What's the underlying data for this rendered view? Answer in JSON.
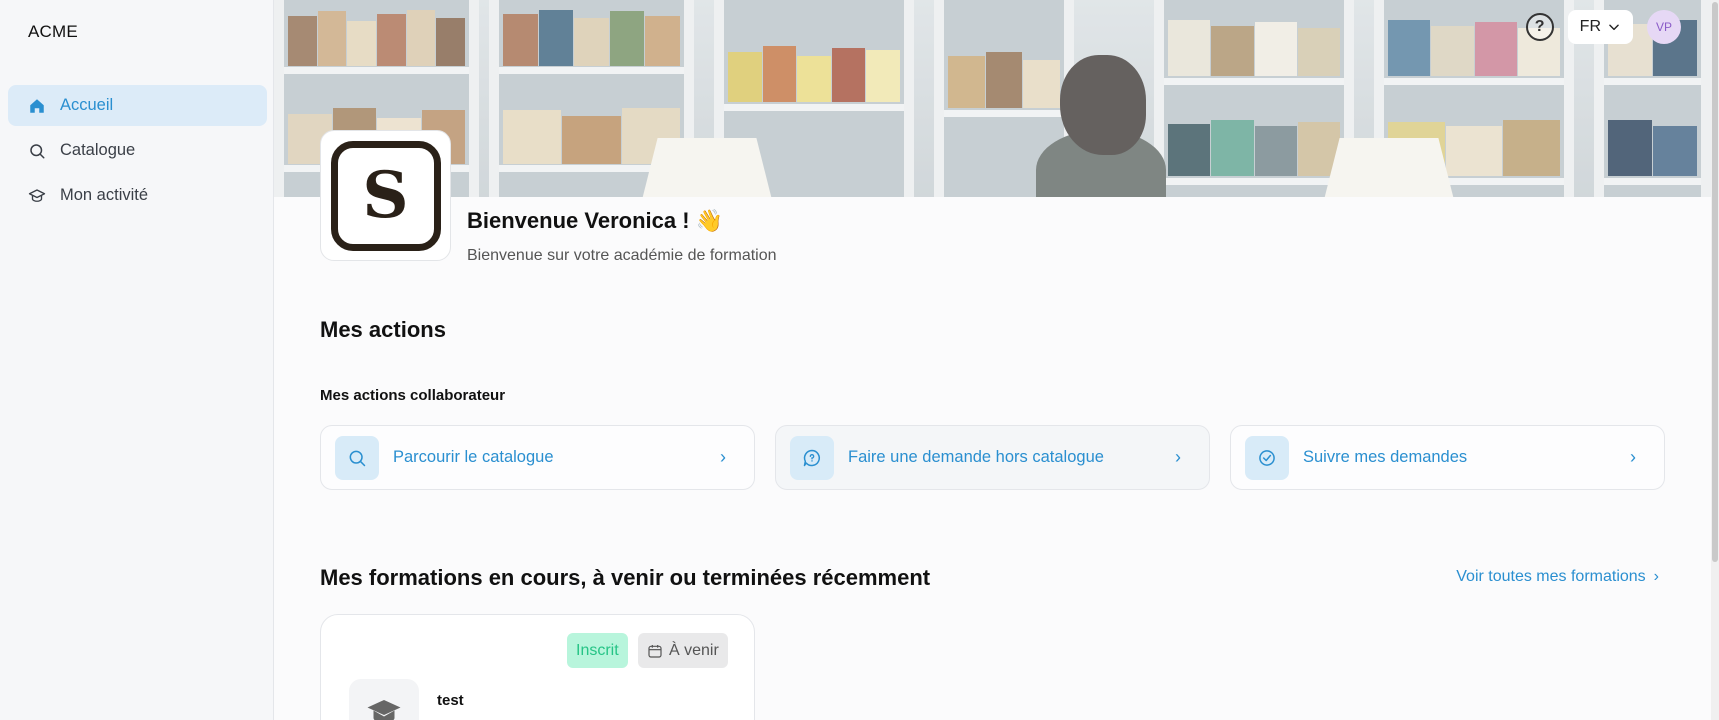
{
  "app": {
    "brand": "ACME"
  },
  "sidebar": {
    "items": [
      {
        "label": "Accueil",
        "icon": "home-icon",
        "active": true
      },
      {
        "label": "Catalogue",
        "icon": "search-icon",
        "active": false
      },
      {
        "label": "Mon activité",
        "icon": "graduation-cap-icon",
        "active": false
      }
    ]
  },
  "header": {
    "help_icon": "help-circle-icon",
    "language": "FR",
    "avatar_initials": "VP"
  },
  "welcome": {
    "logo_letter": "S",
    "title": "Bienvenue Veronica ! 👋",
    "subtitle": "Bienvenue sur votre académie de formation"
  },
  "actions": {
    "title": "Mes actions",
    "subtitle": "Mes actions collaborateur",
    "cards": [
      {
        "label": "Parcourir le catalogue",
        "icon": "search-icon"
      },
      {
        "label": "Faire une demande hors catalogue",
        "icon": "chat-question-icon"
      },
      {
        "label": "Suivre mes demandes",
        "icon": "check-circle-icon"
      }
    ]
  },
  "trainings": {
    "title": "Mes formations en cours, à venir ou terminées récemment",
    "see_all": "Voir toutes mes formations",
    "items": [
      {
        "status": "Inscrit",
        "timing": "À venir",
        "title": "test"
      }
    ]
  },
  "colors": {
    "accent": "#2a8fd0",
    "active_bg": "#dcebf8",
    "enrolled_bg": "#b8f5dc",
    "enrolled_text": "#26c486",
    "avatar_bg": "#e6d8f5"
  }
}
